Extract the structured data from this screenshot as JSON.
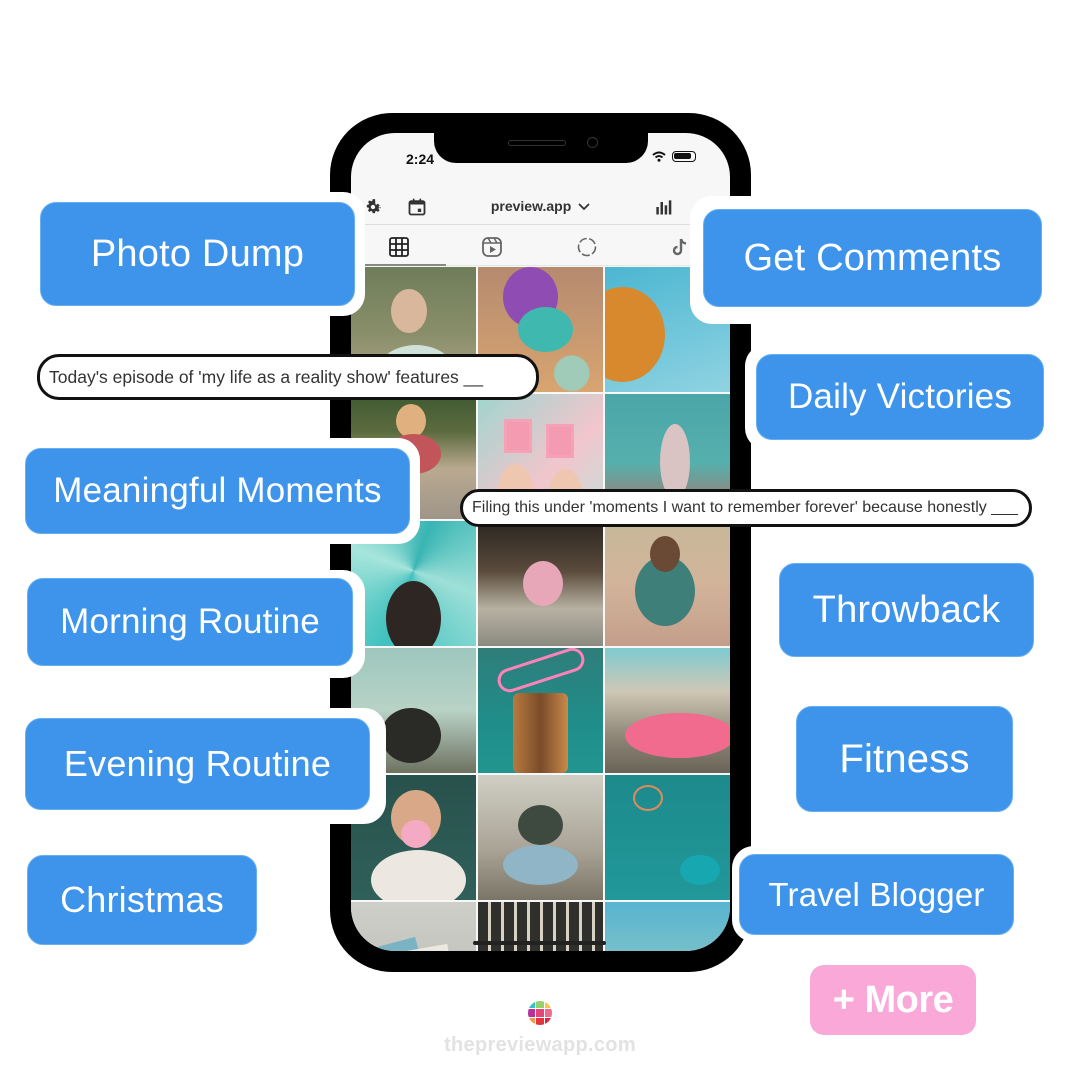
{
  "phone": {
    "status_time": "2:24",
    "header": {
      "title": "preview.app",
      "left_icons": [
        "gear-icon",
        "calendar-icon"
      ],
      "right_icons": [
        "bar-chart-icon"
      ]
    },
    "tabs": [
      {
        "name": "grid",
        "icon": "grid-icon",
        "active": true
      },
      {
        "name": "reels",
        "icon": "reels-icon",
        "active": false
      },
      {
        "name": "stories",
        "icon": "stories-icon",
        "active": false
      },
      {
        "name": "tiktok",
        "icon": "tiktok-icon",
        "active": false
      }
    ],
    "grid_photos": [
      {
        "desc": "woman blowing bubbles"
      },
      {
        "desc": "plush toy over ball pit"
      },
      {
        "desc": "swing ride against sky"
      },
      {
        "desc": "woman on skate ramp"
      },
      {
        "desc": "hands holding polaroids"
      },
      {
        "desc": "woman with palm trees"
      },
      {
        "desc": "ferris wheel heart hands"
      },
      {
        "desc": "roller skater night"
      },
      {
        "desc": "woman crouching on skates"
      },
      {
        "desc": "couple under palm trees"
      },
      {
        "desc": "Orlando neon churros"
      },
      {
        "desc": "pink vintage car"
      },
      {
        "desc": "woman blowing bubble gum"
      },
      {
        "desc": "woman with donut"
      },
      {
        "desc": "basketball hoop dunk"
      },
      {
        "desc": "postcards on table"
      },
      {
        "desc": "photo wall"
      },
      {
        "desc": "palm trees sky"
      }
    ]
  },
  "tags": {
    "photo_dump": "Photo Dump",
    "get_comments": "Get Comments",
    "daily_victories": "Daily Victories",
    "meaningful_moments": "Meaningful Moments",
    "morning_routine": "Morning Routine",
    "throwback": "Throwback",
    "evening_routine": "Evening Routine",
    "fitness": "Fitness",
    "christmas": "Christmas",
    "travel_blogger": "Travel Blogger",
    "more": "+ More"
  },
  "captions": {
    "caption_1": "Today's episode of 'my life as a reality show' features __",
    "caption_2": "Filing this under 'moments I want to remember forever' because honestly ___"
  },
  "footer": {
    "website": "thepreviewapp.com"
  },
  "colors": {
    "tag_blue": "#3d94ea",
    "more_pink": "#f9a8d8"
  }
}
